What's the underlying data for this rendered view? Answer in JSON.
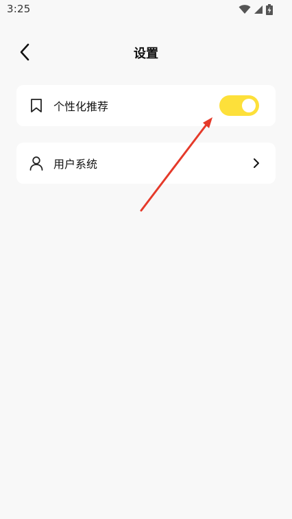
{
  "status_bar": {
    "time": "3:25"
  },
  "header": {
    "title": "设置",
    "back_icon": "chevron-left-icon"
  },
  "settings": {
    "personalized_recommendation": {
      "label": "个性化推荐",
      "icon": "bookmark-icon",
      "enabled": true
    },
    "user_system": {
      "label": "用户系统",
      "icon": "user-icon",
      "trailing_icon": "chevron-right-icon"
    }
  },
  "colors": {
    "background": "#f8f8f8",
    "card": "#ffffff",
    "toggle_on": "#fde03a",
    "annotation": "#e53a2a"
  }
}
